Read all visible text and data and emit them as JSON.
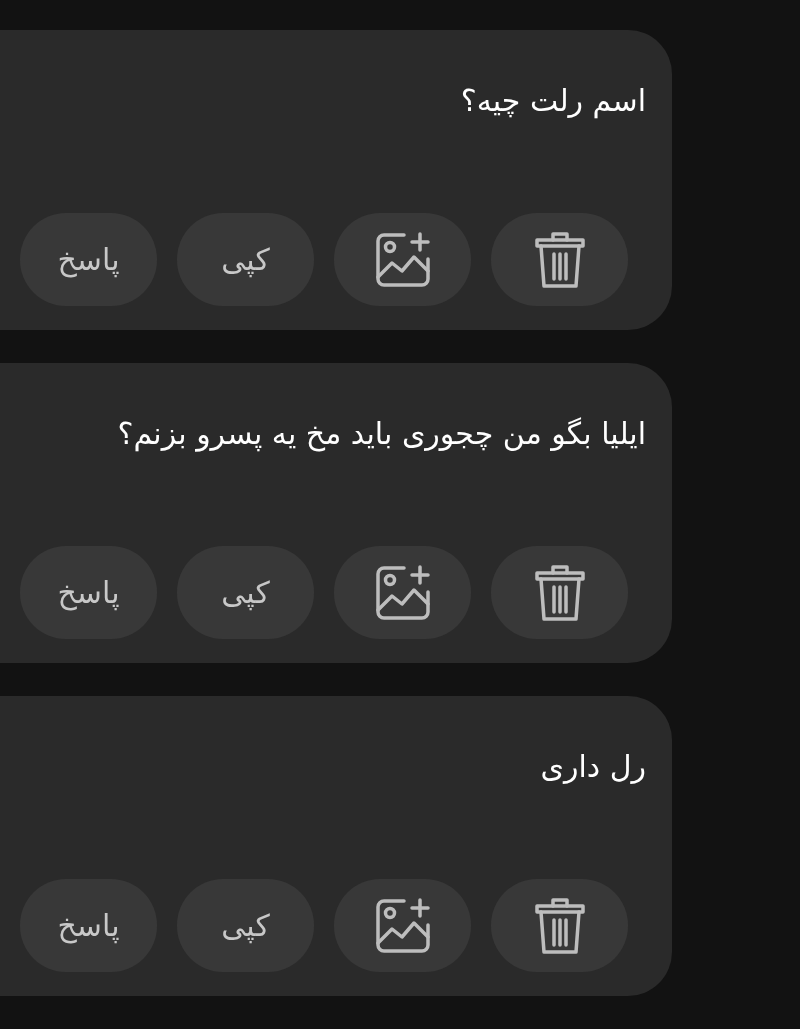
{
  "messages": [
    {
      "text": "اسم رلت چیه؟",
      "actions": [
        {
          "kind": "delete"
        },
        {
          "kind": "image"
        },
        {
          "kind": "text",
          "label": "کپی"
        },
        {
          "kind": "text",
          "label": "پاسخ"
        }
      ]
    },
    {
      "text": "ایلیا بگو من چجوری باید مخ یه پسرو بزنم؟",
      "actions": [
        {
          "kind": "delete"
        },
        {
          "kind": "image"
        },
        {
          "kind": "text",
          "label": "کپی"
        },
        {
          "kind": "text",
          "label": "پاسخ"
        }
      ]
    },
    {
      "text": "رل داری",
      "actions": [
        {
          "kind": "delete"
        },
        {
          "kind": "image"
        },
        {
          "kind": "text",
          "label": "کپی"
        },
        {
          "kind": "text",
          "label": "پاسخ"
        }
      ]
    }
  ]
}
